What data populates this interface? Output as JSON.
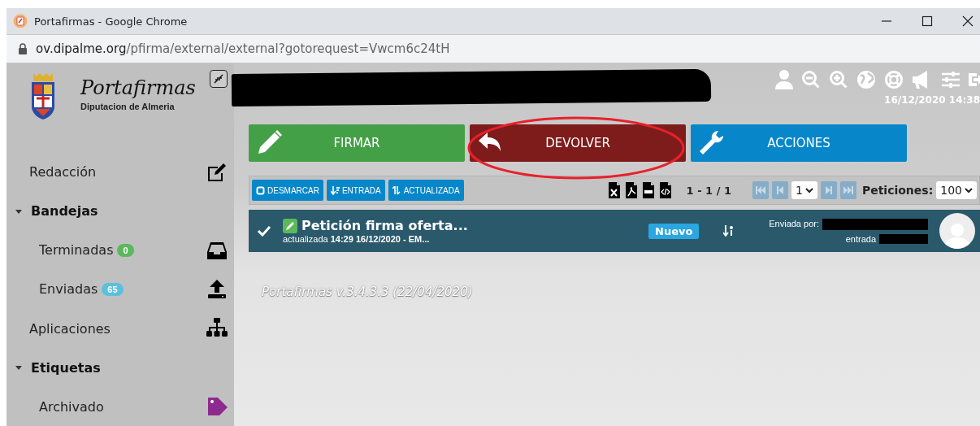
{
  "window": {
    "title": "Portafirmas - Google Chrome",
    "url_host": "ov.dipalme.org",
    "url_path": "/pfirma/external/external?gotorequest=Vwcm6c24tH"
  },
  "header": {
    "app_name": "Portafirmas",
    "organization": "Diputacion de Almeria",
    "datetime": "16/12/2020 14:38"
  },
  "sidebar": {
    "items": [
      {
        "kind": "link",
        "label": "Redacción"
      },
      {
        "kind": "section",
        "label": "Bandejas",
        "expanded": true
      },
      {
        "kind": "subitem",
        "label": "Terminadas",
        "badge": "0",
        "color": "#5cb85c"
      },
      {
        "kind": "subitem",
        "label": "Enviadas",
        "badge": "65",
        "color": "#5bc0de"
      },
      {
        "kind": "link",
        "label": "Aplicaciones"
      },
      {
        "kind": "section",
        "label": "Etiquetas",
        "expanded": true
      },
      {
        "kind": "subitem",
        "label": "Archivado"
      }
    ]
  },
  "actions": [
    {
      "label": "FIRMAR",
      "color": "#43a047"
    },
    {
      "label": "DEVOLVER",
      "color": "#7e1c1c"
    },
    {
      "label": "ACCIONES",
      "color": "#0787c9"
    }
  ],
  "toolbar": {
    "buttons": [
      "DESMARCAR",
      "ENTRADA",
      "ACTUALIZADA"
    ],
    "range": "1 - 1 / 1",
    "page": "1",
    "page_size_label": "Peticiones:",
    "page_size": "100"
  },
  "requests": [
    {
      "checked": true,
      "title": "Petición firma oferta...",
      "updated_label": "actualizada",
      "updated_value": "14:29 16/12/2020 -  EM...",
      "status": "Nuevo",
      "sender_label": "Enviada por:",
      "entry_label": "entrada"
    }
  ],
  "version": "Portafirmas v.3.4.3.3 (22/04/2020)"
}
